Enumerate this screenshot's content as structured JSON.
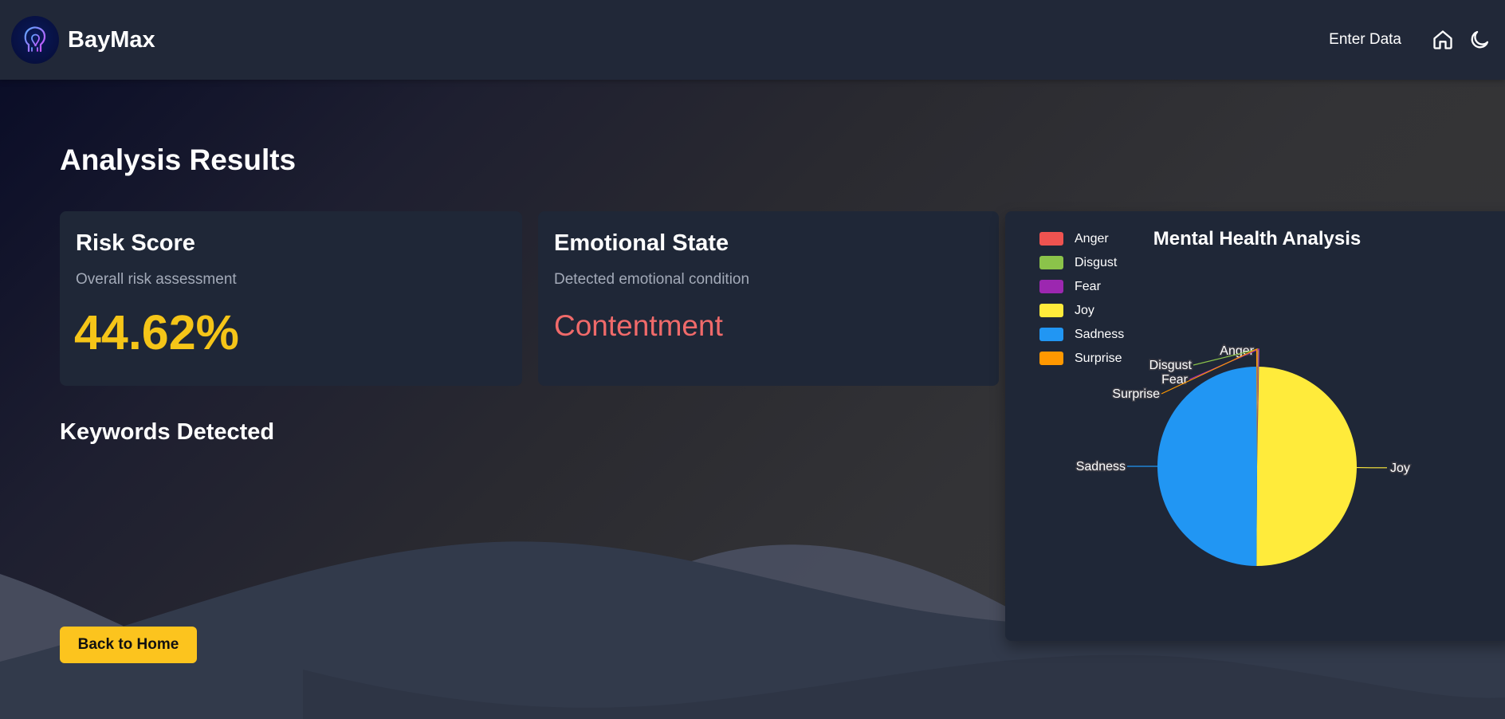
{
  "app": {
    "name": "BayMax"
  },
  "nav": {
    "enter_data": "Enter Data",
    "home_icon": "home-icon",
    "theme_icon": "moon-icon"
  },
  "page": {
    "title": "Analysis Results"
  },
  "risk": {
    "title": "Risk Score",
    "subtitle": "Overall risk assessment",
    "value": "44.62%"
  },
  "emotion": {
    "title": "Emotional State",
    "subtitle": "Detected emotional condition",
    "value": "Contentment"
  },
  "keywords": {
    "title": "Keywords Detected"
  },
  "actions": {
    "back_home": "Back to Home"
  },
  "colors": {
    "accent": "#fcc41e",
    "risk_value": "#f5c518",
    "emotion_value": "#f06a6a",
    "card": "#1f2737",
    "navbar": "#212838"
  },
  "chart_data": {
    "type": "pie",
    "title": "Mental Health Analysis",
    "legend_position": "top-left",
    "categories": [
      "Anger",
      "Disgust",
      "Fear",
      "Joy",
      "Sadness",
      "Surprise"
    ],
    "colors": [
      "#ef5350",
      "#8bc34a",
      "#9c27b0",
      "#ffeb3b",
      "#2196f3",
      "#ff9800"
    ],
    "values": [
      0.001,
      0.001,
      0.001,
      0.5,
      0.5,
      0.001
    ]
  }
}
